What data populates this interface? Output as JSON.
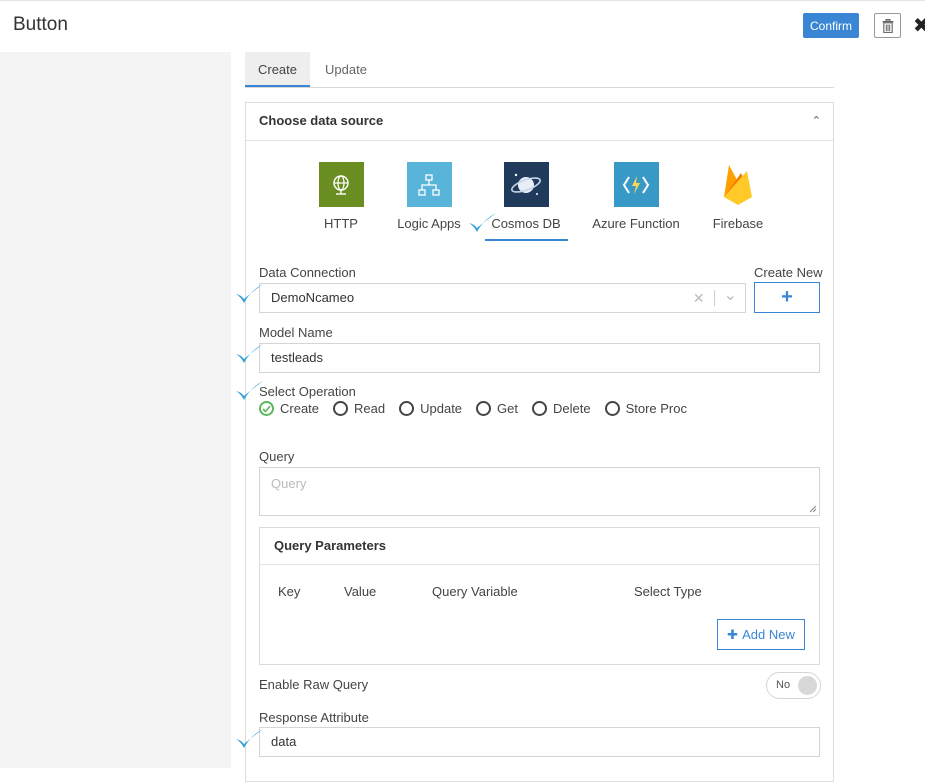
{
  "header": {
    "title": "Button",
    "confirm_label": "Confirm",
    "trash_icon": "trash-icon",
    "close_icon": "close-icon",
    "close_glyph": "✖"
  },
  "tabs": [
    {
      "label": "Create",
      "active": true
    },
    {
      "label": "Update",
      "active": false
    }
  ],
  "data_source": {
    "heading": "Choose data source",
    "chevron_glyph": "⌃",
    "selected": "Cosmos DB",
    "sources": [
      {
        "label": "HTTP",
        "icon": "globe-icon",
        "color": "#6b8e23"
      },
      {
        "label": "Logic Apps",
        "icon": "logic-apps-icon",
        "color": "#59b4d9"
      },
      {
        "label": "Cosmos DB",
        "icon": "cosmos-db-icon",
        "color": "#1f3a5a"
      },
      {
        "label": "Azure Function",
        "icon": "azure-function-icon",
        "color": "#3999c6"
      },
      {
        "label": "Firebase",
        "icon": "firebase-icon",
        "color": "#ffa611"
      }
    ]
  },
  "data_connection": {
    "label": "Data Connection",
    "value": "DemoNcameo",
    "clear_glyph": "✕",
    "dropdown_glyph": "⌄",
    "create_new_label": "Create New",
    "create_new_glyph": "+"
  },
  "model_name": {
    "label": "Model Name",
    "value": "testleads"
  },
  "operation": {
    "label": "Select Operation",
    "selected": "Create",
    "options": [
      "Create",
      "Read",
      "Update",
      "Get",
      "Delete",
      "Store Proc"
    ]
  },
  "query": {
    "label": "Query",
    "placeholder": "Query"
  },
  "query_parameters": {
    "heading": "Query Parameters",
    "columns": [
      "Key",
      "Value",
      "Query Variable",
      "Select Type"
    ],
    "add_new_label": "Add New",
    "add_new_glyph": "✚"
  },
  "raw_query": {
    "label": "Enable Raw Query",
    "toggle_text": "No"
  },
  "response_attribute": {
    "label": "Response Attribute",
    "value": "data"
  },
  "colors": {
    "accent": "#3a86d4",
    "checkmark": "#39a0d6",
    "radio_checked": "#5cb85c"
  }
}
